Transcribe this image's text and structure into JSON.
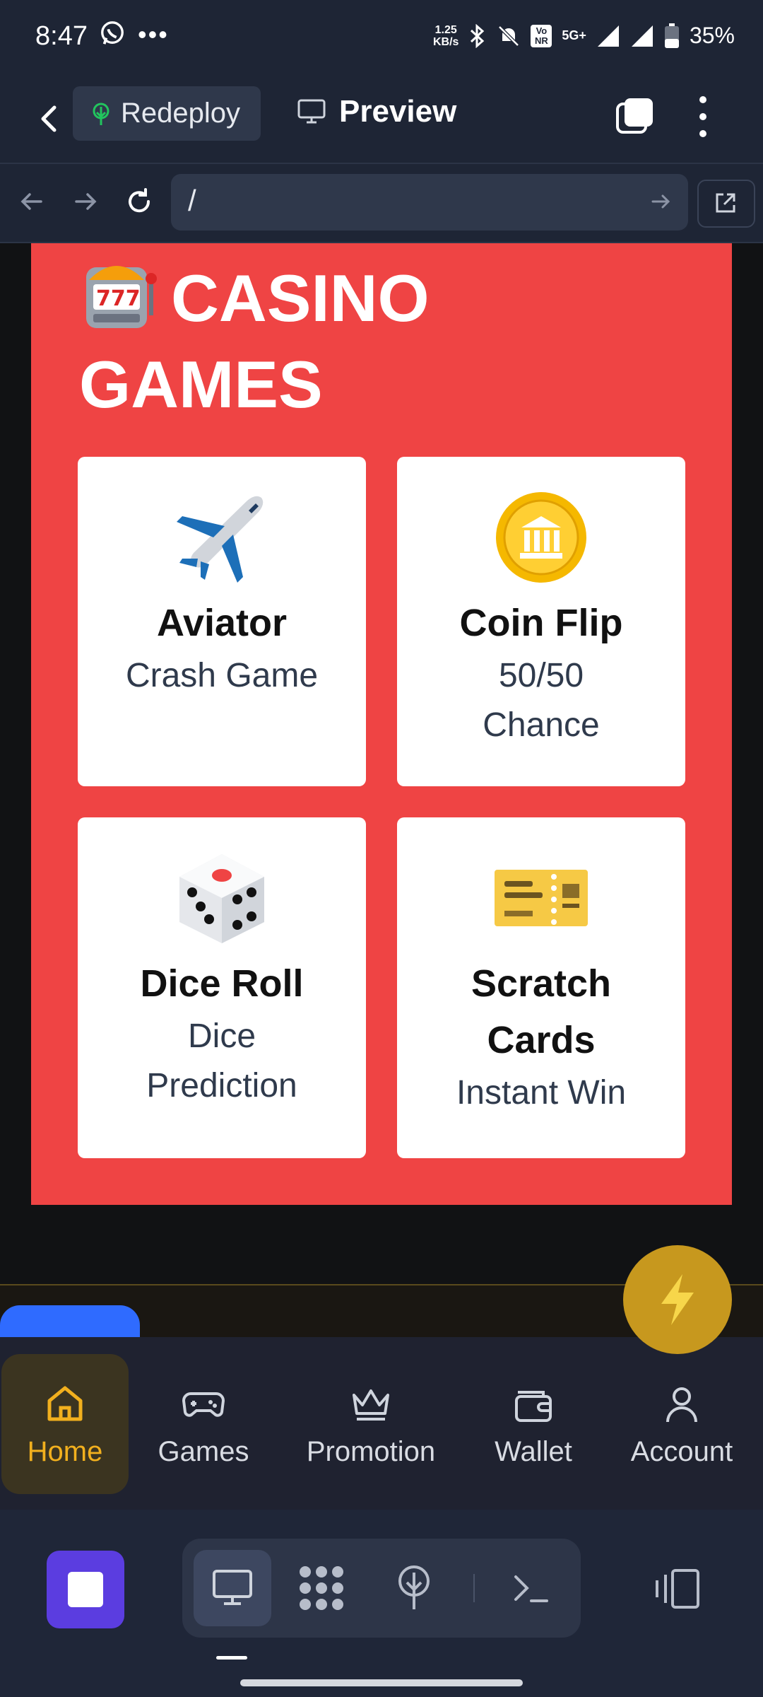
{
  "status_bar": {
    "time": "8:47",
    "net_speed_value": "1.25",
    "net_speed_unit": "KB/s",
    "volte": "Vo NR",
    "network": "5G+",
    "battery": "35%"
  },
  "app_bar": {
    "redeploy_label": "Redeploy",
    "preview_label": "Preview"
  },
  "browser": {
    "url": "/"
  },
  "page": {
    "title_emoji": "🎰",
    "title": "CASINO GAMES",
    "games": [
      {
        "emoji": "✈️",
        "name": "Aviator",
        "subtitle": "Crash Game"
      },
      {
        "emoji": "🪙",
        "name": "Coin Flip",
        "subtitle": "50/50 Chance"
      },
      {
        "emoji": "🎲",
        "name": "Dice Roll",
        "subtitle": "Dice Prediction"
      },
      {
        "emoji": "🎫",
        "name": "Scratch Cards",
        "subtitle": "Instant Win"
      }
    ]
  },
  "fab_icon": "lightning-icon",
  "bottom_nav": [
    {
      "label": "Home",
      "icon": "home-icon",
      "active": true
    },
    {
      "label": "Games",
      "icon": "gamepad-icon",
      "active": false
    },
    {
      "label": "Promotion",
      "icon": "crown-icon",
      "active": false
    },
    {
      "label": "Wallet",
      "icon": "wallet-icon",
      "active": false
    },
    {
      "label": "Account",
      "icon": "user-icon",
      "active": false
    }
  ],
  "colors": {
    "panel": "#ef4444",
    "accent_gold": "#f2b01e",
    "stop_button": "#5b3de0",
    "chrome_bg": "#1e2535"
  }
}
